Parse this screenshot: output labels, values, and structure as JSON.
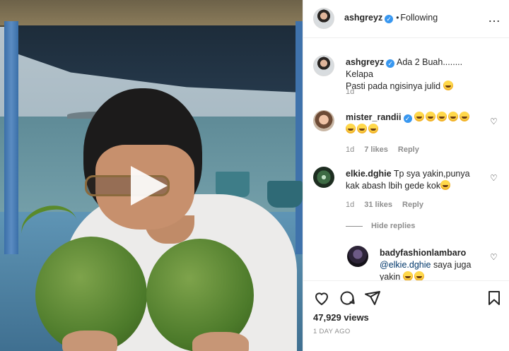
{
  "post": {
    "author": "ashgreyz",
    "follow_status": "Following",
    "caption_line1": "Ada 2 Buah........ Kelapa",
    "caption_line2": "Pasti pada ngisinya julid",
    "caption_age": "1d",
    "views": "47,929 views",
    "posted": "1 DAY AGO"
  },
  "comments": [
    {
      "username": "mister_randii",
      "verified": true,
      "emoji_count": 8,
      "age": "1d",
      "likes": "7 likes",
      "reply_label": "Reply"
    },
    {
      "username": "elkie.dghie",
      "verified": false,
      "text_line1": "Tp sya yakin,punya",
      "text_line2": "kak abash lbih gede kok",
      "age": "1d",
      "likes": "31 likes",
      "reply_label": "Reply",
      "hide_replies_label": "Hide replies",
      "replies": [
        {
          "username": "badyfashionlambaro",
          "mention": "@elkie.dghie",
          "text_line1": "saya juga",
          "text_line2": "yakin"
        }
      ]
    }
  ],
  "icons": {
    "more": "more-options-icon",
    "like": "heart-icon",
    "comment": "comment-icon",
    "share": "share-icon",
    "save": "bookmark-icon",
    "play": "play-icon",
    "verified": "verified-badge-icon"
  }
}
